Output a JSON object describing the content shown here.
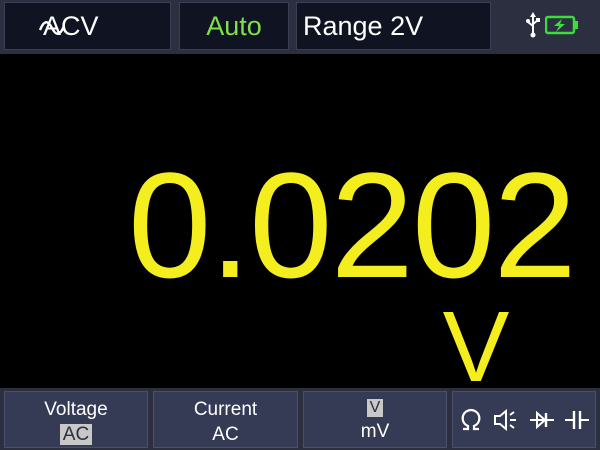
{
  "header": {
    "mode_label": "ACV",
    "auto_label": "Auto",
    "range_label": "Range 2V",
    "icons": [
      "ac-wave-icon",
      "usb-icon",
      "battery-charging-icon"
    ]
  },
  "display": {
    "reading": "0.0202",
    "unit": "V",
    "color": "#f4ee1e"
  },
  "softkeys": {
    "voltage": {
      "label": "Voltage",
      "value": "AC"
    },
    "current": {
      "label": "Current",
      "value": "AC"
    },
    "range": {
      "label": "V",
      "value": "mV"
    },
    "functions": [
      "ohm-icon",
      "continuity-buzzer-icon",
      "diode-icon",
      "capacitor-icon"
    ]
  },
  "colors": {
    "auto_green": "#7fe04a",
    "bar_bg": "#2b2f3f",
    "battery_green": "#3ddc3d"
  }
}
